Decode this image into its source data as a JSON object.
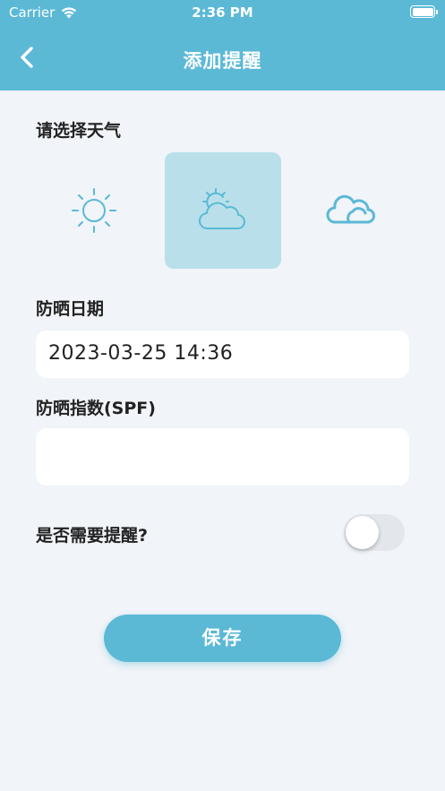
{
  "status_bar": {
    "carrier": "Carrier",
    "time": "2:36 PM"
  },
  "nav": {
    "title": "添加提醒",
    "back_icon": "chevron-left-icon"
  },
  "weather": {
    "label": "请选择天气",
    "options": [
      {
        "icon": "sun-icon",
        "selected": false
      },
      {
        "icon": "partly-cloudy-icon",
        "selected": true
      },
      {
        "icon": "cloud-icon",
        "selected": false
      }
    ]
  },
  "date": {
    "label": "防晒日期",
    "value": "2023-03-25 14:36"
  },
  "spf": {
    "label": "防晒指数(SPF)",
    "value": ""
  },
  "reminder": {
    "label": "是否需要提醒?",
    "enabled": false
  },
  "save_label": "保存",
  "colors": {
    "accent": "#5bb9d6",
    "selected_bg": "#b9e0ea",
    "background": "#f1f4f8"
  }
}
